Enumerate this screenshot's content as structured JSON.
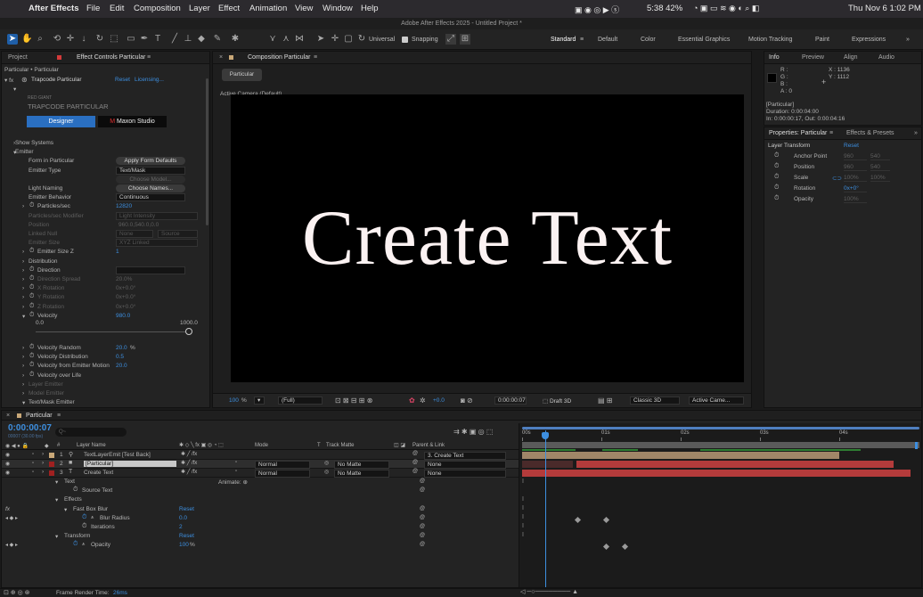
{
  "menubar": {
    "app": "After Effects",
    "items": [
      "File",
      "Edit",
      "Composition",
      "Layer",
      "Effect",
      "Animation",
      "View",
      "Window",
      "Help"
    ],
    "battery": "5:38 42%",
    "clock": "Thu Nov 6  1:02 PM"
  },
  "titlebar": "Adobe After Effects 2025 - Untitled Project *",
  "toolbar": {
    "universal": "Universal",
    "snapping": "Snapping",
    "workspaces": [
      "Standard",
      "Default",
      "Color",
      "Essential Graphics",
      "Motion Tracking",
      "Paint",
      "Expressions"
    ]
  },
  "left_panel": {
    "tabs": [
      "Project",
      "Effect Controls Particular"
    ],
    "breadcrumb": "Particular • Particular",
    "effect_name": "Trapcode Particular",
    "reset": "Reset",
    "licensing": "Licensing...",
    "brand_top": "RED GIANT",
    "brand": "TRAPCODE PARTICULAR",
    "designer_btn": "Designer",
    "maxon_btn": "Maxon Studio",
    "rows": [
      {
        "label": "Show Systems",
        "indent": 0,
        "tw": "right"
      },
      {
        "label": "Emitter",
        "indent": 0,
        "tw": "down"
      },
      {
        "label": "Form in Particular",
        "indent": 1,
        "btn": "Apply Form Defaults"
      },
      {
        "label": "Emitter Type",
        "indent": 1,
        "dd": "Text/Mask"
      },
      {
        "label": "",
        "indent": 1,
        "btn_dim": "Choose Model..."
      },
      {
        "label": "Light Naming",
        "indent": 1,
        "btn": "Choose Names..."
      },
      {
        "label": "Emitter Behavior",
        "indent": 1,
        "dd": "Continuous"
      },
      {
        "label": "Particles/sec",
        "indent": 1,
        "tw": "right",
        "sw": true,
        "value": "12820"
      },
      {
        "label": "Particles/sec Modifier",
        "indent": 1,
        "dim": true,
        "dd_dim": "Light Intensity"
      },
      {
        "label": "Position",
        "indent": 1,
        "dim": true,
        "gvalue": "960.0,540.0,0.0"
      },
      {
        "label": "Linked Null",
        "indent": 1,
        "dim": true,
        "dd_dim": "None",
        "dd_dim2": "Source"
      },
      {
        "label": "Emitter Size",
        "indent": 1,
        "dim": true,
        "dd_dim": "XYZ Linked"
      },
      {
        "label": "Emitter Size Z",
        "indent": 1,
        "tw": "right",
        "sw": true,
        "value": "1"
      },
      {
        "label": "Distribution",
        "indent": 1,
        "tw": "right"
      },
      {
        "label": "Direction",
        "indent": 1,
        "tw": "right",
        "sw": true,
        "dd": ""
      },
      {
        "label": "Direction Spread",
        "indent": 1,
        "tw": "right",
        "sw": true,
        "dim": true,
        "gvalue": "20.0%"
      },
      {
        "label": "X Rotation",
        "indent": 1,
        "tw": "right",
        "sw": true,
        "dim": true,
        "gvalue": "0x+0.0°"
      },
      {
        "label": "Y Rotation",
        "indent": 1,
        "tw": "right",
        "sw": true,
        "dim": true,
        "gvalue": "0x+0.0°"
      },
      {
        "label": "Z Rotation",
        "indent": 1,
        "tw": "right",
        "sw": true,
        "dim": true,
        "gvalue": "0x+0.0°"
      },
      {
        "label": "Velocity",
        "indent": 1,
        "tw": "down",
        "sw": true,
        "value": "980.0"
      }
    ],
    "slider_min": "0.0",
    "slider_max": "1000.0",
    "slider_level": 0.98,
    "rows2": [
      {
        "label": "Velocity Random",
        "value": "20.0",
        "unit": "%",
        "tw": "right",
        "sw": true
      },
      {
        "label": "Velocity Distribution",
        "value": "0.5",
        "tw": "right",
        "sw": true
      },
      {
        "label": "Velocity from Emitter Motion",
        "value": "20.0",
        "tw": "right",
        "sw": true
      },
      {
        "label": "Velocity over Life",
        "tw": "right",
        "sw": true
      },
      {
        "label": "Layer Emitter",
        "tw": "right",
        "dim": true
      },
      {
        "label": "Model Emitter",
        "tw": "right",
        "dim": true
      },
      {
        "label": "Text/Mask Emitter",
        "tw": "down"
      }
    ]
  },
  "comp": {
    "tab": "Composition Particular",
    "subtab": "Particular",
    "camera": "Active Camera (Default)",
    "text": "Create Text",
    "footer": {
      "zoom": "100",
      "zoom_unit": "%",
      "resolution": "(Full)",
      "exposure": "+0.0",
      "time": "0:00:00:07",
      "draft": "Draft 3D",
      "renderer": "Classic 3D",
      "view": "Active Came..."
    }
  },
  "right_panel": {
    "tabs": [
      "Info",
      "Preview",
      "Align",
      "Audio"
    ],
    "rgb": [
      "R :",
      "G :",
      "B :",
      "A : 0"
    ],
    "x": "X : 1136",
    "y": "Y : 1112",
    "layer_info": [
      "[Particular]",
      "Duration: 0:00:04:00",
      "In: 0:00:00:17, Out: 0:00:04:16"
    ],
    "props_tabs": [
      "Properties: Particular",
      "Effects & Presets"
    ],
    "layer_transform": "Layer Transform",
    "reset": "Reset",
    "props": [
      {
        "label": "Anchor Point",
        "v1": "960",
        "v2": "540",
        "dim": true
      },
      {
        "label": "Position",
        "v1": "960",
        "v2": "540",
        "dim": true
      },
      {
        "label": "Scale",
        "v1": "100%",
        "v2": "100%",
        "dim": true,
        "link": true
      },
      {
        "label": "Rotation",
        "v1": "0x+0°",
        "dim": false
      },
      {
        "label": "Opacity",
        "v1": "100%",
        "dim": true
      }
    ]
  },
  "timeline": {
    "tab": "Particular",
    "timecode": "0:00:00:07",
    "fps": "00007 (30.00 fps)",
    "search_placeholder": "Q~",
    "columns": [
      "#",
      "Layer Name",
      "Mode",
      "T",
      "Track Matte",
      "Parent & Link"
    ],
    "ruler": [
      "00s",
      "01s",
      "02s",
      "03s",
      "04s"
    ],
    "layers": [
      {
        "num": "1",
        "name": "TextLayerEmit [Test Back]",
        "color": "#c9a878",
        "mode": "",
        "matte": "",
        "parent": "3. Create Text",
        "selected": false
      },
      {
        "num": "2",
        "name": "[Particular]",
        "color": "#a02020",
        "mode": "Normal",
        "matte": "No Matte",
        "parent": "None",
        "selected": true
      },
      {
        "num": "3",
        "name": "Create Text",
        "color": "#a02020",
        "mode": "Normal",
        "matte": "No Matte",
        "parent": "None",
        "selected": false
      }
    ],
    "props": [
      {
        "label": "Text",
        "indent": 1,
        "tw": "down",
        "extra": "Animate:"
      },
      {
        "label": "Source Text",
        "indent": 2,
        "sw": true
      },
      {
        "label": "Effects",
        "indent": 1,
        "tw": "down"
      },
      {
        "label": "Fast Box Blur",
        "indent": 2,
        "tw": "down",
        "reset": "Reset",
        "fx": true
      },
      {
        "label": "Blur Radius",
        "indent": 3,
        "value": "0.0",
        "kf": true
      },
      {
        "label": "Iterations",
        "indent": 3,
        "value": "2"
      },
      {
        "label": "Transform",
        "indent": 1,
        "tw": "down",
        "reset": "Reset"
      },
      {
        "label": "Opacity",
        "indent": 2,
        "value": "100",
        "unit": "%",
        "kf": true
      }
    ],
    "render_label": "Frame Render Time:",
    "render_value": "26ms"
  }
}
